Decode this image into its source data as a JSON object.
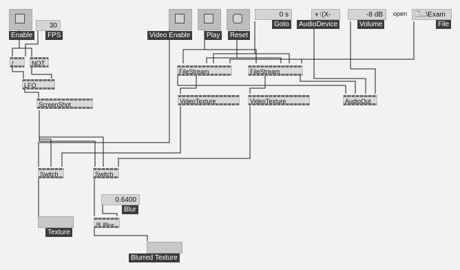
{
  "controls": {
    "enable": {
      "label": "Enable"
    },
    "fps": {
      "value": "30",
      "label": "FPS"
    },
    "video_enable": {
      "label": "Video Enable"
    },
    "play": {
      "label": "Play"
    },
    "reset": {
      "label": "Reset"
    },
    "goto": {
      "value": "0 s",
      "label": "Goto"
    },
    "audio_device": {
      "value": "(X-Fi)",
      "label": "AudioDevice"
    },
    "volume": {
      "value": "-8 dB",
      "label": "Volume"
    },
    "file": {
      "prefix": "open",
      "value": "...\\Exam",
      "label": "File"
    },
    "blur": {
      "value": "0.6400",
      "label": "Blur"
    }
  },
  "objects": {
    "divide": "/",
    "not": "NOT",
    "lfo": "LFO",
    "screenshot": "ScreenShot",
    "filestream1": "FileStream",
    "filestream2": "FileStream",
    "videotexture1": "VideoTexture",
    "videotexture2": "VideoTexture",
    "audioout": "AudioOut",
    "switch1": "Switch",
    "switch2": "Switch",
    "blur": "Blur"
  },
  "outputs": {
    "texture": {
      "label": "Texture"
    },
    "blurred_texture": {
      "label": "Blurred Texture"
    }
  },
  "icons": {
    "dropdown": "triangle-down-icon",
    "file": "document-icon",
    "blur": "sliders-icon"
  }
}
